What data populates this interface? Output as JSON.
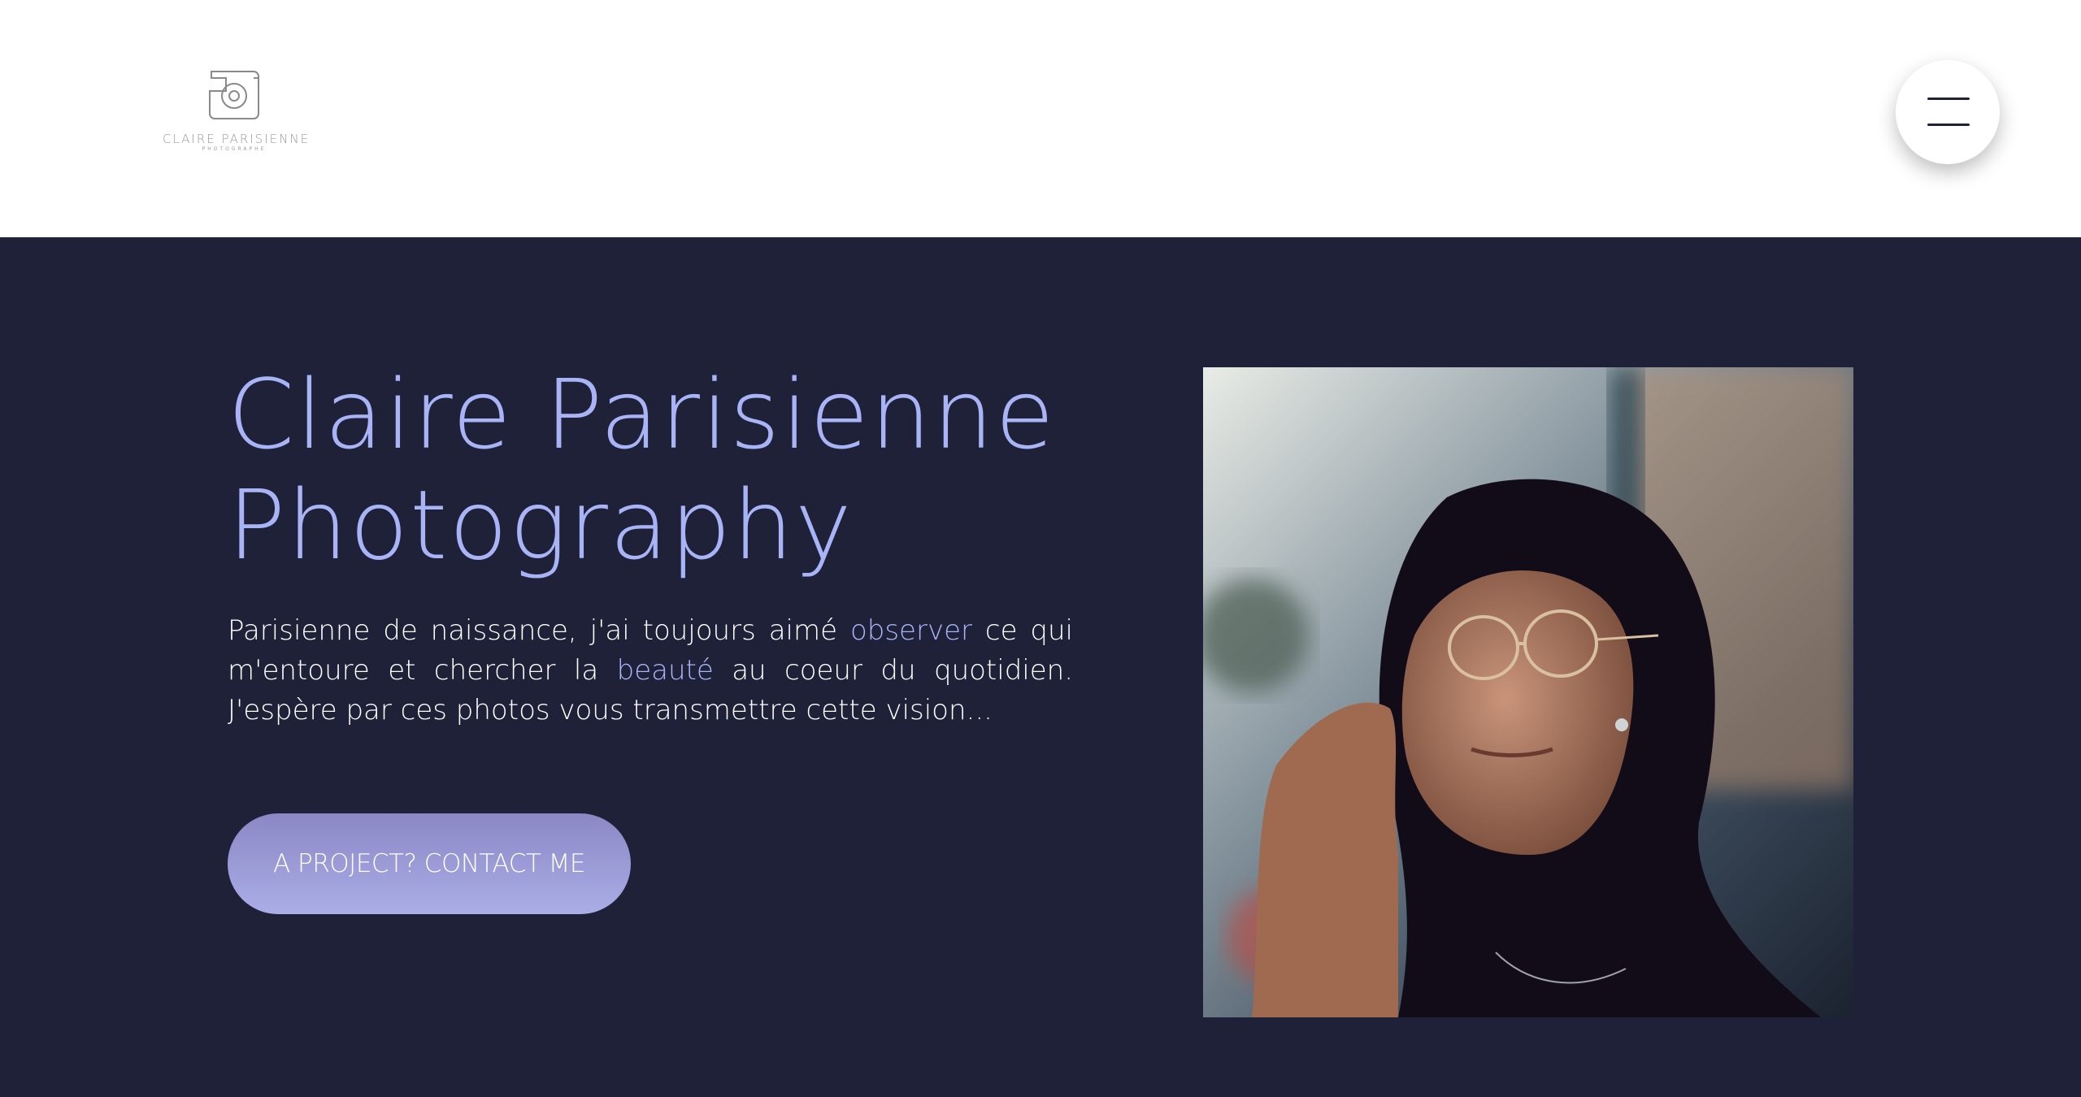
{
  "header": {
    "logo": {
      "name": "CLAIRE PARISIENNE",
      "subtitle": "PHOTOGRAPHE",
      "icon": "camera-icon"
    },
    "menu_icon": "hamburger-menu-icon"
  },
  "hero": {
    "title_line1": "Claire Parisienne",
    "title_line2": "Photography",
    "text": {
      "part1": "Parisienne de naissance, j'ai toujours aimé ",
      "accent1": "observer",
      "part2": " ce qui m'entoure et chercher la ",
      "accent2": "beauté",
      "part3": " au coeur du quotidien. J'espère par ces photos vous transmettre cette vision..."
    },
    "cta_label": "A PROJECT? CONTACT ME",
    "portrait": "portrait-photo"
  },
  "colors": {
    "background_dark": "#1f2139",
    "accent": "#a8b4f5",
    "button_gradient_start": "#8b87c5",
    "button_gradient_end": "#aaaee7",
    "text": "#ffffff"
  }
}
